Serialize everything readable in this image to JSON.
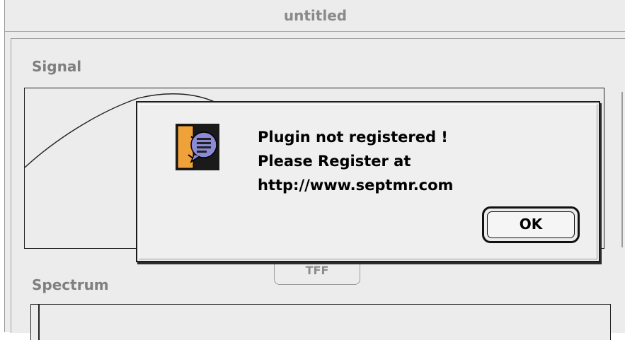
{
  "window": {
    "title": "untitled"
  },
  "panels": {
    "signal_label": "Signal",
    "spectrum_label": "Spectrum",
    "tff_button": "TFF"
  },
  "dialog": {
    "icon": "alert-caution-icon",
    "message_lines": [
      "Plugin not registered !",
      "Please Register at",
      "http://www.septmr.com"
    ],
    "ok_label": "OK"
  },
  "colors": {
    "window_bg": "#ececec",
    "dialog_bg": "#efefef",
    "icon_orange": "#f0a23a",
    "icon_purple": "#8a8ad6"
  }
}
